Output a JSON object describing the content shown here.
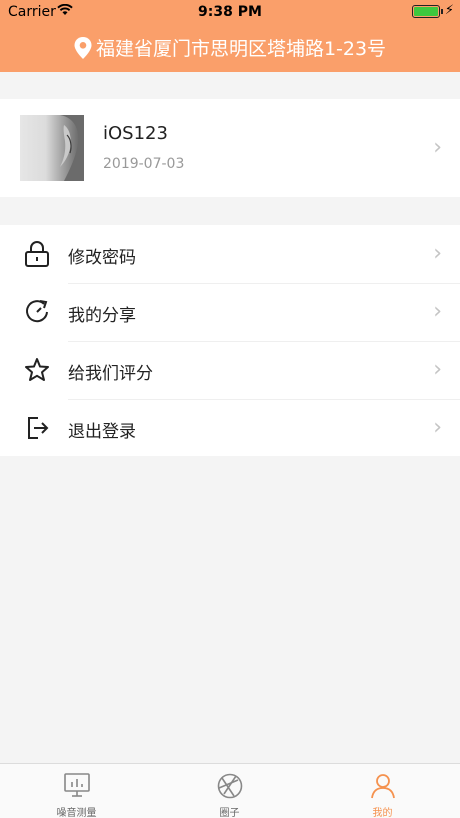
{
  "status_bar": {
    "carrier": "Carrier",
    "time": "9:38 PM"
  },
  "header": {
    "location_text": "福建省厦门市思明区塔埔路1-23号",
    "color": "#fa9f6a"
  },
  "profile": {
    "username": "iOS123",
    "date": "2019-07-03"
  },
  "menu": {
    "items": [
      {
        "label": "修改密码",
        "icon": "lock-icon"
      },
      {
        "label": "我的分享",
        "icon": "share-icon"
      },
      {
        "label": "给我们评分",
        "icon": "star-icon"
      },
      {
        "label": "退出登录",
        "icon": "logout-icon"
      }
    ]
  },
  "tabbar": {
    "tabs": [
      {
        "label": "噪音测量",
        "icon": "monitor-icon"
      },
      {
        "label": "圈子",
        "icon": "aperture-icon"
      },
      {
        "label": "我的",
        "icon": "person-icon",
        "active": true
      }
    ],
    "active_color": "#f5924f"
  }
}
